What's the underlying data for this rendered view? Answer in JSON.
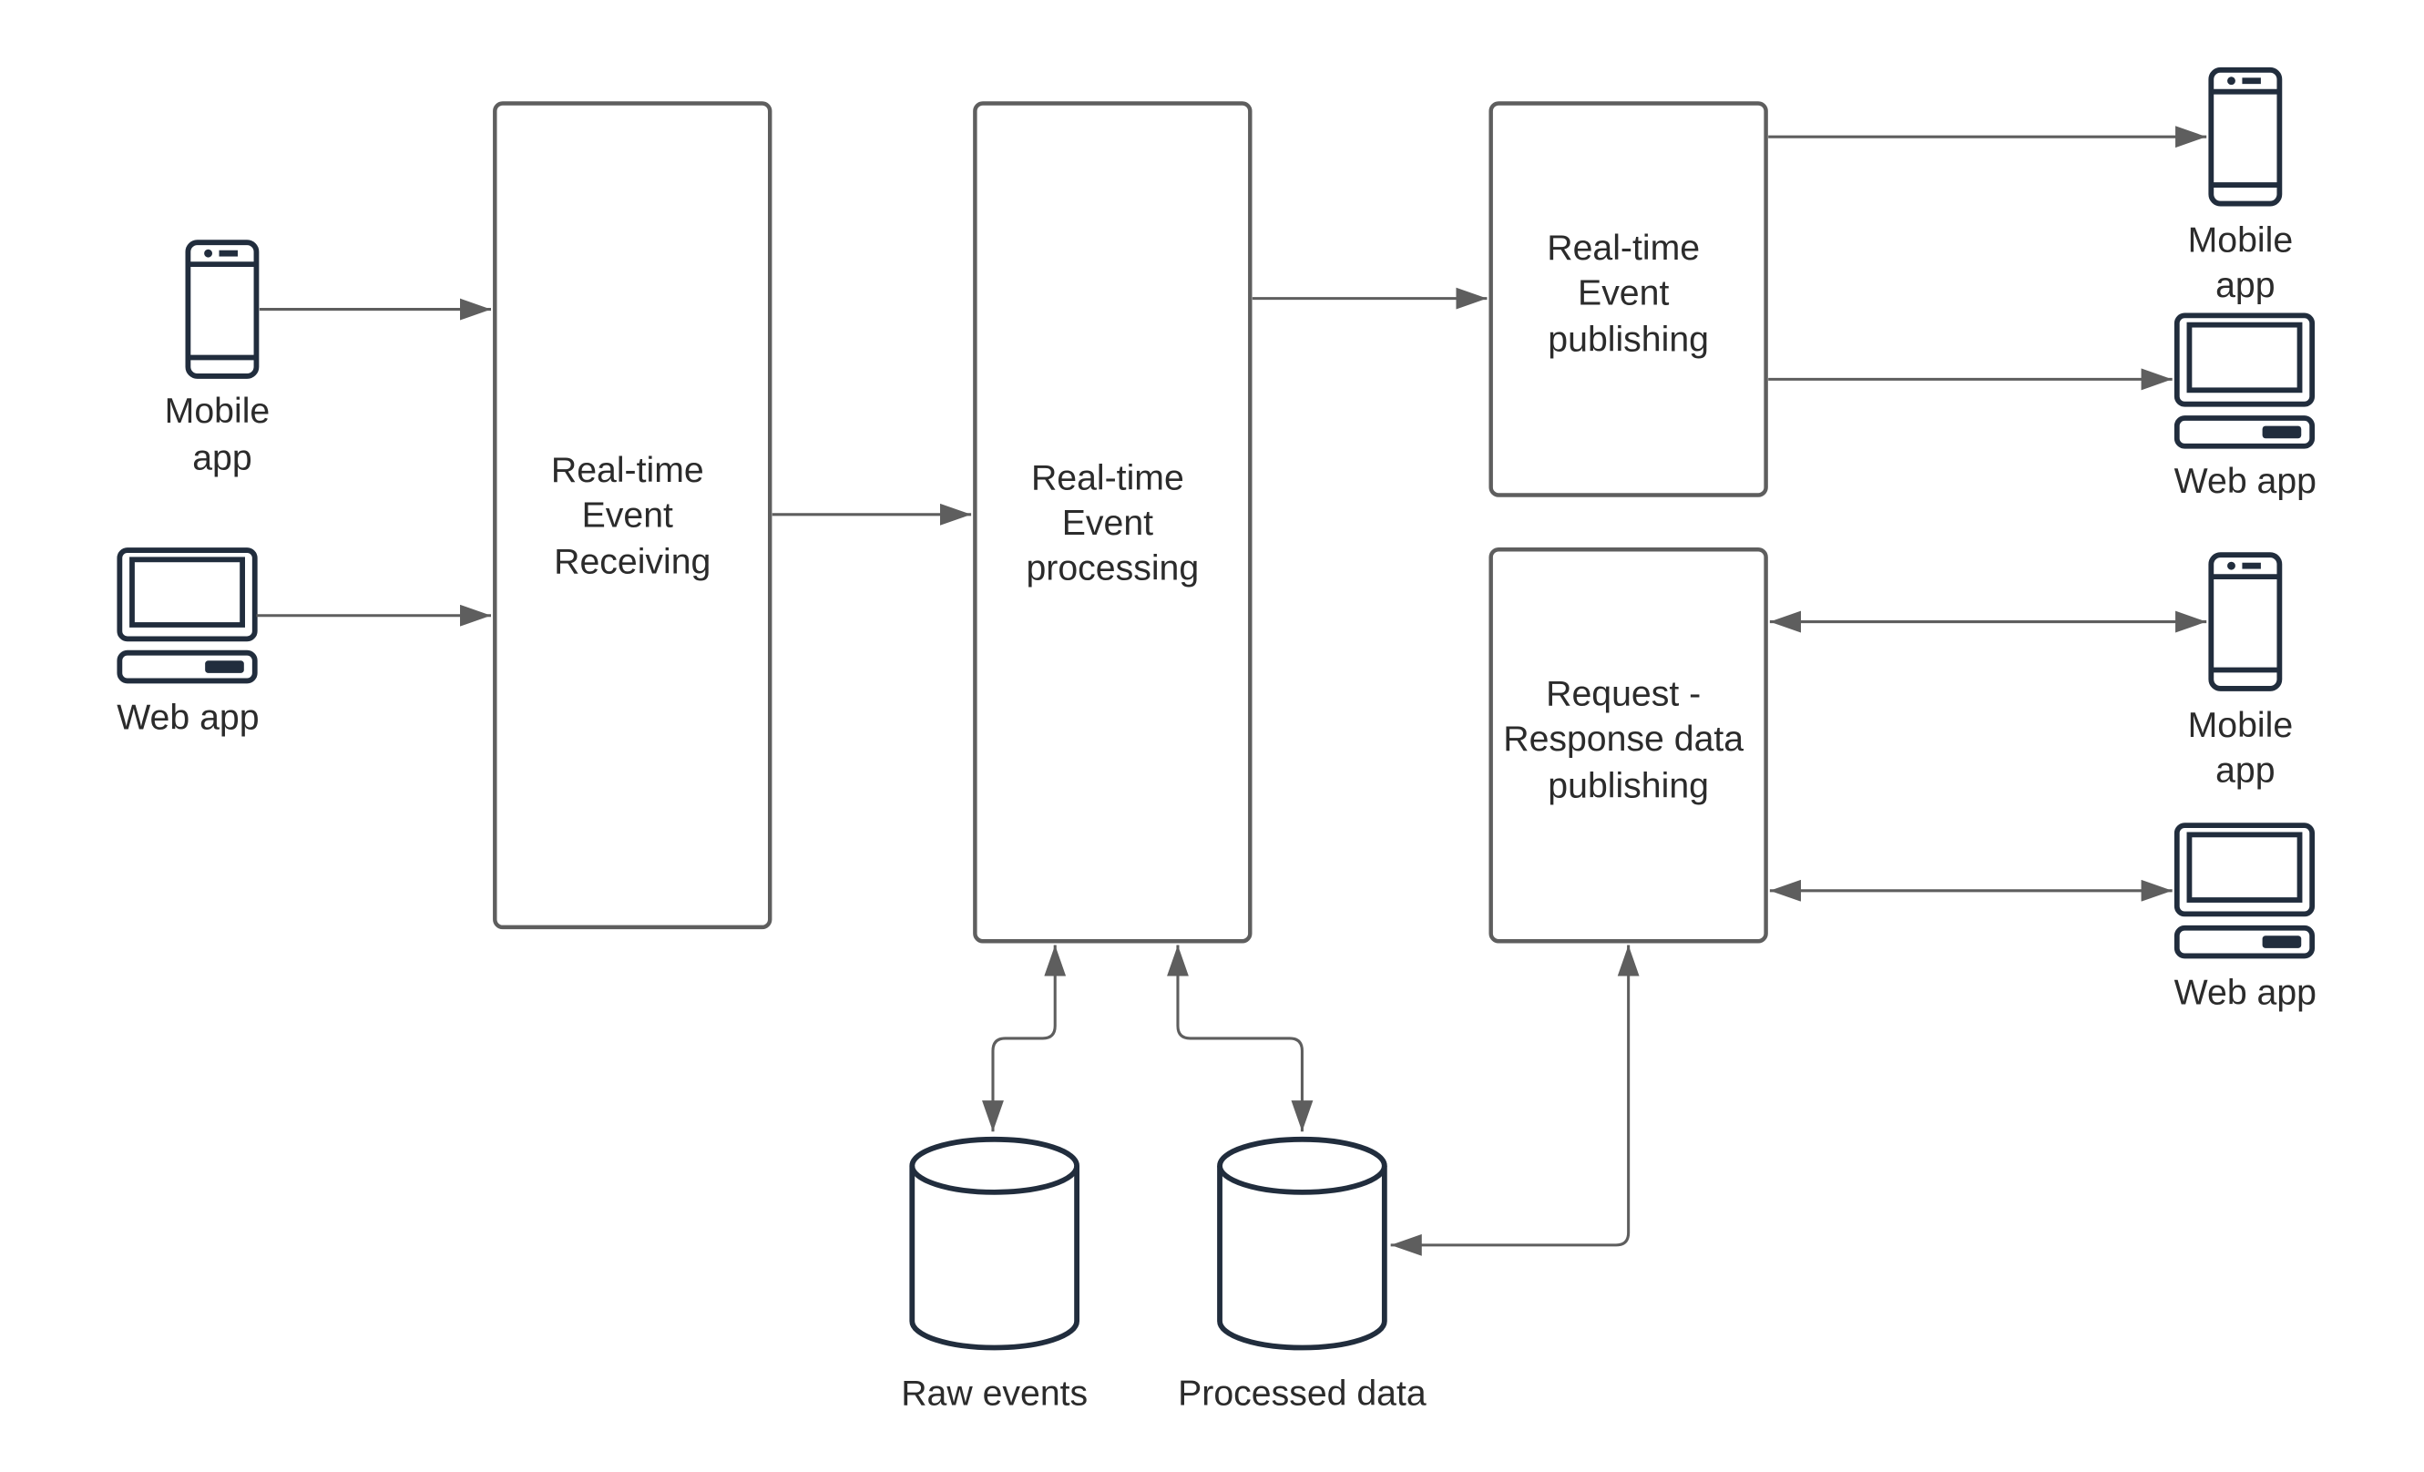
{
  "diagram": {
    "nodes": {
      "receiving": {
        "lines": [
          "Real-time",
          "Event",
          "Receiving"
        ]
      },
      "processing": {
        "lines": [
          "Real-time",
          "Event",
          "processing"
        ]
      },
      "publishing": {
        "lines": [
          "Real-time",
          "Event",
          "publishing"
        ]
      },
      "request_response": {
        "lines": [
          "Request -",
          "Response data",
          "publishing"
        ]
      }
    },
    "clients": {
      "left_mobile": {
        "icon": "mobile-phone-icon",
        "lines": [
          "Mobile",
          "app"
        ]
      },
      "left_web": {
        "icon": "desktop-computer-icon",
        "lines": [
          "Web app"
        ]
      },
      "pub_mobile": {
        "icon": "mobile-phone-icon",
        "lines": [
          "Mobile",
          "app"
        ]
      },
      "pub_web": {
        "icon": "desktop-computer-icon",
        "lines": [
          "Web app"
        ]
      },
      "rr_mobile": {
        "icon": "mobile-phone-icon",
        "lines": [
          "Mobile",
          "app"
        ]
      },
      "rr_web": {
        "icon": "desktop-computer-icon",
        "lines": [
          "Web app"
        ]
      }
    },
    "stores": {
      "raw": {
        "icon": "database-icon",
        "label": "Raw events"
      },
      "processed": {
        "icon": "database-icon",
        "label": "Processed data"
      }
    },
    "edges": [
      {
        "from": "left_mobile",
        "to": "receiving",
        "direction": "forward"
      },
      {
        "from": "left_web",
        "to": "receiving",
        "direction": "forward"
      },
      {
        "from": "receiving",
        "to": "processing",
        "direction": "forward"
      },
      {
        "from": "processing",
        "to": "publishing",
        "direction": "forward"
      },
      {
        "from": "publishing",
        "to": "pub_mobile",
        "direction": "forward"
      },
      {
        "from": "publishing",
        "to": "pub_web",
        "direction": "forward"
      },
      {
        "from": "request_response",
        "to": "rr_mobile",
        "direction": "both"
      },
      {
        "from": "request_response",
        "to": "rr_web",
        "direction": "both"
      },
      {
        "from": "processing",
        "to": "raw",
        "direction": "both"
      },
      {
        "from": "processing",
        "to": "processed",
        "direction": "both"
      },
      {
        "from": "processed",
        "to": "request_response",
        "direction": "both"
      }
    ],
    "colors": {
      "connector": "#5e5e5e",
      "icon": "#212d3d",
      "text": "#2b2b2b"
    }
  }
}
